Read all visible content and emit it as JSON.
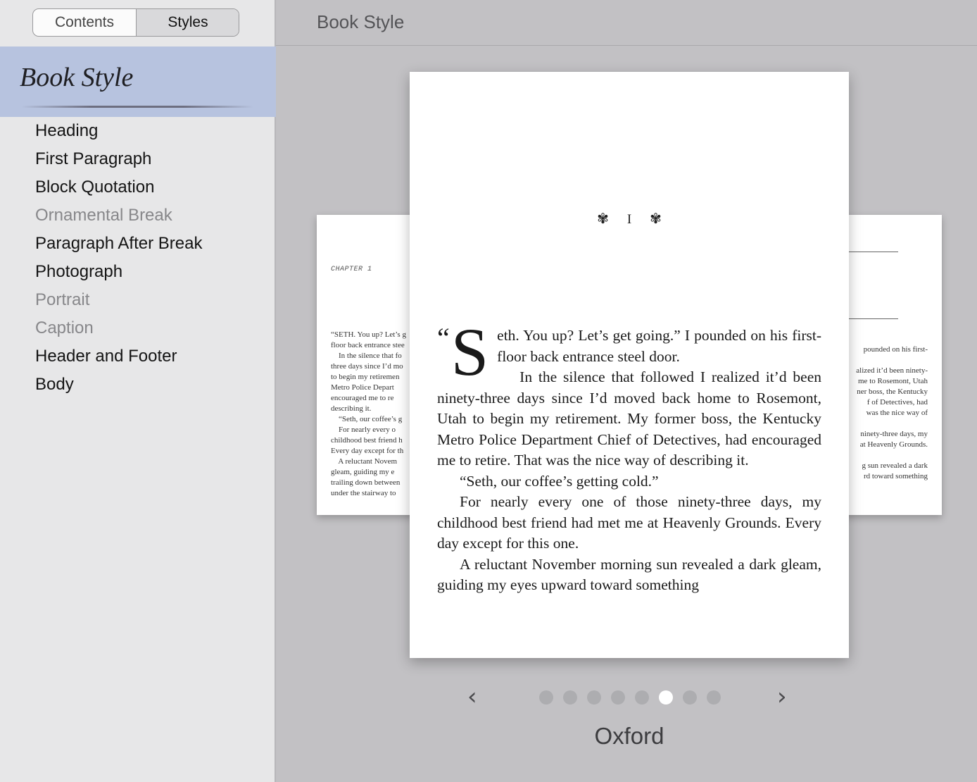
{
  "sidebar": {
    "segmented": {
      "left": "Contents",
      "right": "Styles",
      "selected": "Styles"
    },
    "header_title": "Book Style",
    "items": [
      {
        "label": "Heading",
        "dim": false
      },
      {
        "label": "First Paragraph",
        "dim": false
      },
      {
        "label": "Block Quotation",
        "dim": false
      },
      {
        "label": "Ornamental Break",
        "dim": true
      },
      {
        "label": "Paragraph After Break",
        "dim": false
      },
      {
        "label": "Photograph",
        "dim": false
      },
      {
        "label": "Portrait",
        "dim": true
      },
      {
        "label": "Caption",
        "dim": true
      },
      {
        "label": "Header and Footer",
        "dim": false
      },
      {
        "label": "Body",
        "dim": false
      }
    ]
  },
  "main": {
    "title": "Book Style",
    "preview": {
      "left_page": {
        "chapter_label": "CHAPTER 1",
        "lines": [
          "“SETH. You up? Let’s g",
          "floor back entrance stee",
          "    In the silence that fo",
          "three days since I’d mo",
          "to begin my retiremen",
          "Metro Police Depart",
          "encouraged me to re",
          "describing it.",
          "    “Seth, our coffee’s g",
          "    For nearly every o",
          "childhood best friend h",
          "Every day except for th",
          "    A reluctant Novem",
          "gleam, guiding my e",
          "trailing down between",
          "under the stairway to"
        ]
      },
      "right_page": {
        "lines": [
          "pounded on his first-",
          "",
          "alized it’d been ninety-",
          "me to Rosemont, Utah",
          "ner boss, the Kentucky",
          "f of Detectives, had",
          "was the nice way of",
          "",
          "ninety-three days, my",
          "at Heavenly Grounds.",
          "",
          "g sun revealed a dark",
          "rd toward something"
        ]
      },
      "main_page": {
        "ornament_left": "✾",
        "chapter_number": "I",
        "ornament_right": "✾",
        "open_quote": "“",
        "drop_cap": "S",
        "first_para": "eth. You up? Let’s get going.” I pounded on his first-floor back entrance steel door.",
        "paragraphs": [
          "In the silence that followed I realized it’d been ninety-three days since I’d moved back home to Rosemont, Utah to begin my retirement. My former boss, the Kentucky Metro Police Department Chief of Detectives, had encouraged me to retire. That was the nice way of describing it.",
          "“Seth, our coffee’s getting cold.”",
          "For nearly every one of those ninety-three days, my childhood best friend had met me at Heavenly Grounds. Every day except for this one.",
          "A reluctant November morning sun revealed a dark gleam, guiding my eyes upward toward something"
        ]
      }
    },
    "nav": {
      "prev": "‹",
      "next": "›",
      "dot_count": 8,
      "active_index": 5
    },
    "theme_name": "Oxford"
  },
  "colors": {
    "sidebar_bg": "#e7e7e8",
    "selected_header_bg": "#b7c3df",
    "main_bg": "#c2c1c4",
    "dim_text": "#87878a"
  }
}
